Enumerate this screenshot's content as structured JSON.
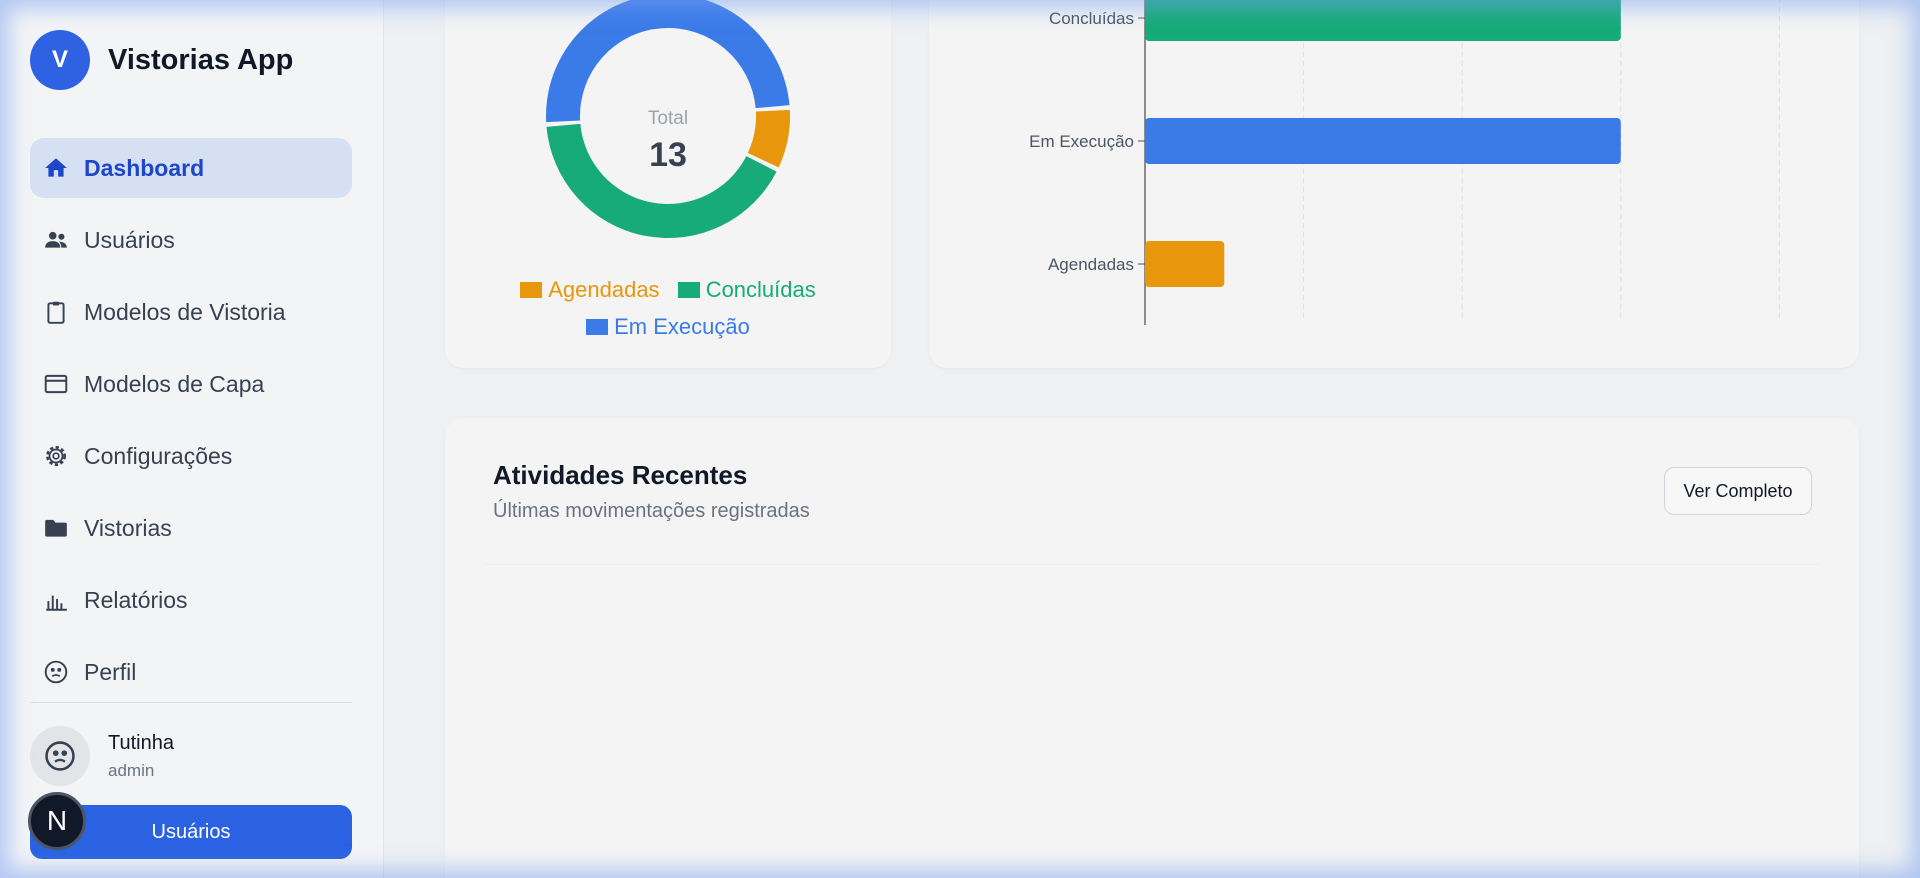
{
  "app": {
    "logo_letter": "V",
    "name": "Vistorias App"
  },
  "sidebar": {
    "items": [
      {
        "label": "Dashboard",
        "icon": "home-icon",
        "active": true
      },
      {
        "label": "Usuários",
        "icon": "users-icon"
      },
      {
        "label": "Modelos de Vistoria",
        "icon": "clipboard-icon"
      },
      {
        "label": "Modelos de Capa",
        "icon": "card-icon"
      },
      {
        "label": "Configurações",
        "icon": "gear-icon"
      },
      {
        "label": "Vistorias",
        "icon": "folder-icon"
      },
      {
        "label": "Relatórios",
        "icon": "bar-chart-icon"
      },
      {
        "label": "Perfil",
        "icon": "face-icon"
      }
    ]
  },
  "user": {
    "name": "Tutinha",
    "role": "admin",
    "button_label": "Usuários"
  },
  "next_badge": "N",
  "colors": {
    "accent": "#2f62e3",
    "agendadas": "#e8960c",
    "concluidas": "#16ab78",
    "em_execucao": "#3b7be8"
  },
  "chart_data": [
    {
      "type": "pie",
      "center_label": "Total",
      "center_value": "13",
      "categories": [
        "Agendadas",
        "Concluídas",
        "Em Execução"
      ],
      "values": [
        1,
        5,
        6
      ]
    },
    {
      "type": "bar",
      "orientation": "horizontal",
      "categories": [
        "Concluídas",
        "Em Execução",
        "Agendadas"
      ],
      "values": [
        6,
        6,
        1
      ],
      "grid": true
    }
  ],
  "activities": {
    "title": "Atividades Recentes",
    "subtitle": "Últimas movimentações registradas",
    "button_label": "Ver Completo"
  }
}
